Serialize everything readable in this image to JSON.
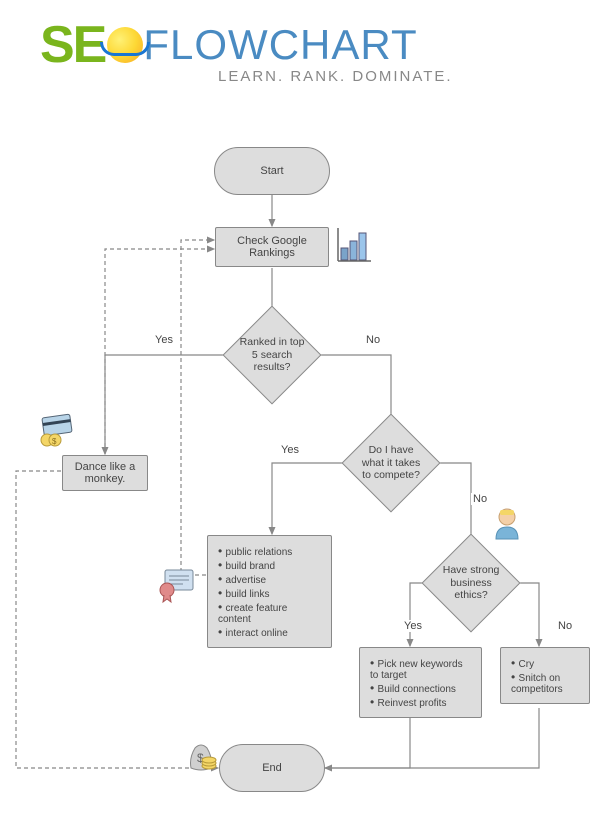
{
  "logo": {
    "se": "SE",
    "flowchart": "FLOWCHART",
    "tagline": "LEARN. RANK. DOMINATE."
  },
  "nodes": {
    "start": "Start",
    "check": "Check Google Rankings",
    "ranked": "Ranked in top 5 search results?",
    "dance": "Dance like a monkey.",
    "compete": "Do I have what it takes to compete?",
    "ethics": "Have strong business ethics?",
    "end": "End"
  },
  "lists": {
    "compete_yes": [
      "public relations",
      "build brand",
      "advertise",
      "build links",
      "create feature content",
      "interact online"
    ],
    "ethics_yes": [
      "Pick new keywords to target",
      "Build connections",
      "Reinvest profits"
    ],
    "ethics_no": [
      "Cry",
      "Snitch on competitors"
    ]
  },
  "labels": {
    "yes": "Yes",
    "no": "No"
  }
}
